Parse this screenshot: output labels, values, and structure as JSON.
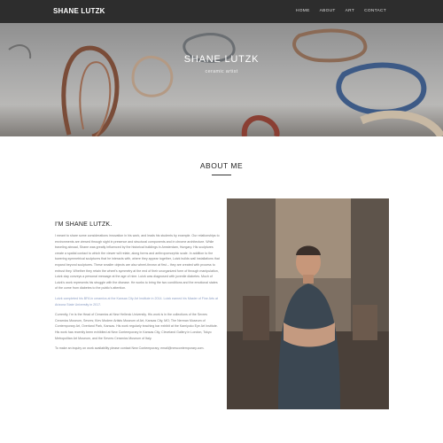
{
  "nav": {
    "brand": "SHANE LUTZK",
    "items": [
      "HOME",
      "ABOUT",
      "ART",
      "CONTACT"
    ]
  },
  "hero": {
    "title": "SHANE LUTZK",
    "subtitle": "ceramic artist"
  },
  "about": {
    "heading": "ABOUT ME",
    "intro_heading": "I'M SHANE LUTZK.",
    "paragraphs": [
      "I meant to share some considerations innovation in his work, and leads his students by example. Our relationships to environments are viewed through sight in presence and structural components and in chrome architecture. While traveling abroad, Shane was greatly influenced by the historical buildings in Amsterdam, Hungary. His sculptures create a spatial contact to which the viewer will relate, along forms and anthropomorphic scale. In addition to the towering symmetrical sculptures that he interacts with, where they appear together, Lutzk builds wall installations that expand beyond sculptures. These smaller objects are also wheel-thrown at first – they are created with process to entrust they. Whether they retain the wheel's symmetry at the end of their unorganized form of through manipulation, Lutzk clay conveys a personal message at the age of nine. Lutzk was diagnosed with juvenile diabetes. Much of Lutzk's work represents his struggle with the disease. He works to bring the two conditions and the emotional states of the come from diabetes to the public's attention.",
      "Lutzk completed his BFA in ceramics at the Kansas City Art Institute in 2014. Lutzk earned his Master of Fine Arts at Arizona State University in 2017.",
      "Currently, I'm is the Head of Ceramics at New Hellenic University. His work is in the collections of the Sevres Ceramics Museum, Sevres; Kiev Modern Artists Museum of Art, Kansas City, MO; The Nerman Museum of Contemporary Art, Overland Park, Kansas. His work regularly teaching bar exhibit at the Kamiyoko Eye Art Institute. His work has recently been exhibited at New Contemporary in Kansas City, Cleveland Gallery in London, Tokyo Metropolitan Art Museum, and the Sevres Ceramics Museum of Italy.",
      "To make an inquiry on work availability please contact New Contemporary, email@newcontemporary.com."
    ]
  },
  "colors": {
    "nav_bg": "#2d2d2d",
    "link": "#8a9cc2"
  }
}
